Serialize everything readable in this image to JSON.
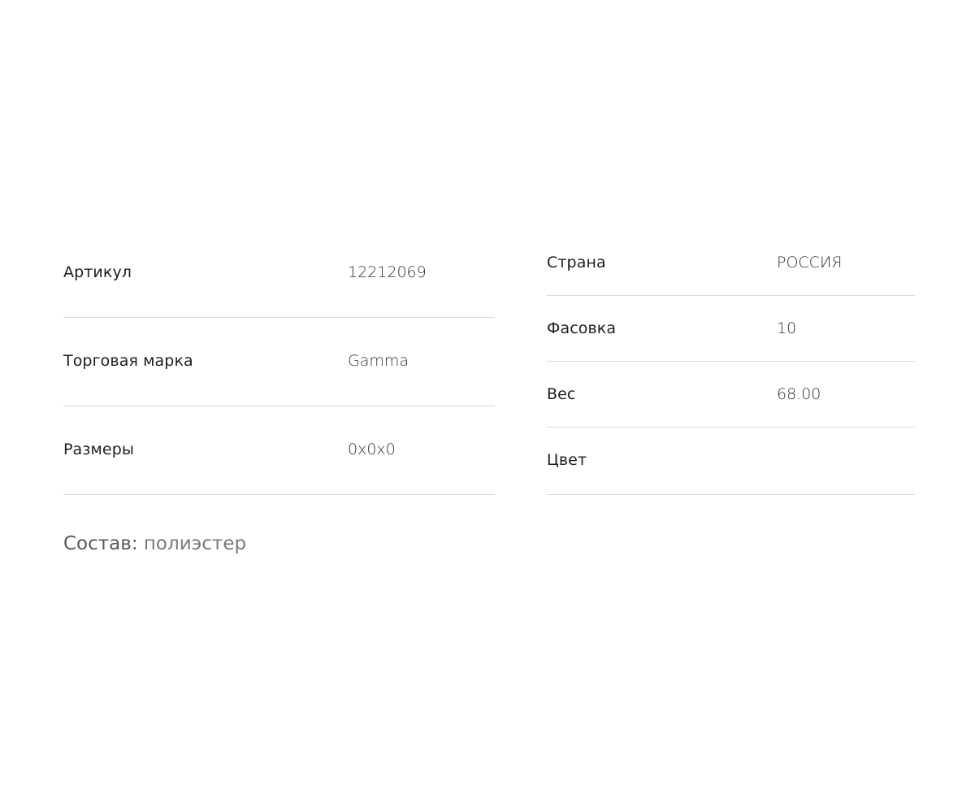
{
  "specs_left": [
    {
      "label": "Артикул",
      "value": "12212069"
    },
    {
      "label": "Торговая марка",
      "value": "Gamma"
    },
    {
      "label": "Размеры",
      "value": "0x0x0"
    }
  ],
  "specs_right": [
    {
      "label": "Страна",
      "value": "РОССИЯ"
    },
    {
      "label": "Фасовка",
      "value": "10"
    },
    {
      "label": "Вес",
      "value": "68.00"
    },
    {
      "label": "Цвет",
      "value": ""
    }
  ],
  "composition": {
    "label": "Состав:",
    "value": "полиэстер"
  }
}
